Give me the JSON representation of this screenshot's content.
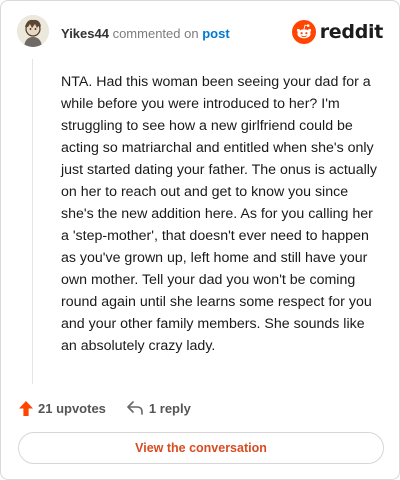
{
  "header": {
    "username": "Yikes44",
    "action_text": "commented on",
    "post_link": "post",
    "brand": "reddit"
  },
  "comment": {
    "text": "NTA. Had this woman been seeing your dad for a while before you were introduced to her? I'm struggling to see how a new girlfriend could be acting so matriarchal and entitled when she's only just started dating your father. The onus is actually on her to reach out and get to know you since she's the new addition here. As for you calling her a 'step-mother', that doesn't ever need to happen as you've grown up, left home and still have your own mother. Tell your dad you won't be coming round again until she learns some respect for you and your other family members. She sounds like an absolutely crazy lady."
  },
  "actions": {
    "upvotes": "21 upvotes",
    "replies": "1 reply"
  },
  "footer": {
    "view_conversation": "View the conversation"
  },
  "icons": {
    "upvote": "upvote-arrow-icon",
    "reply": "reply-arrow-icon",
    "brand": "reddit-snoo-icon",
    "avatar": "user-avatar"
  },
  "colors": {
    "reddit_orange": "#ff4500",
    "link_blue": "#0079d3",
    "button_text": "#d94b20"
  }
}
